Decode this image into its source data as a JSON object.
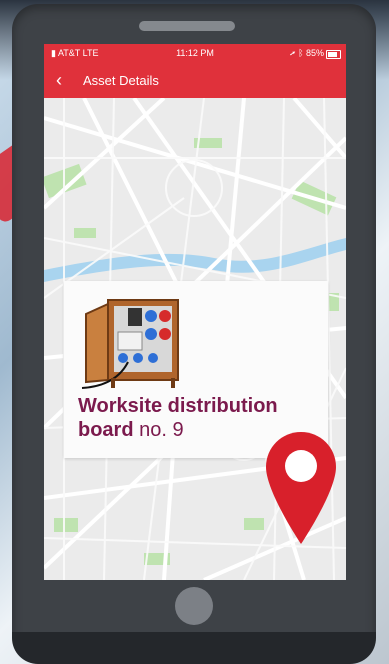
{
  "status_bar": {
    "carrier": "AT&T",
    "network": "LTE",
    "time": "11:12 PM",
    "battery": "85%",
    "battery_level": 0.85
  },
  "nav": {
    "back_icon": "chevron-left-icon",
    "title": "Asset Details"
  },
  "asset": {
    "name": "Worksite distribution board",
    "number": "no. 9"
  },
  "colors": {
    "brand_red": "#e0313b",
    "title_purple": "#7b1a4d",
    "pin_red": "#d8202b",
    "phone_body": "#3e4247"
  },
  "icons": {
    "signal": "signal-bars-icon",
    "location": "location-arrow-icon",
    "bluetooth": "bluetooth-icon",
    "battery": "battery-icon",
    "map_pin": "map-pin-icon"
  }
}
